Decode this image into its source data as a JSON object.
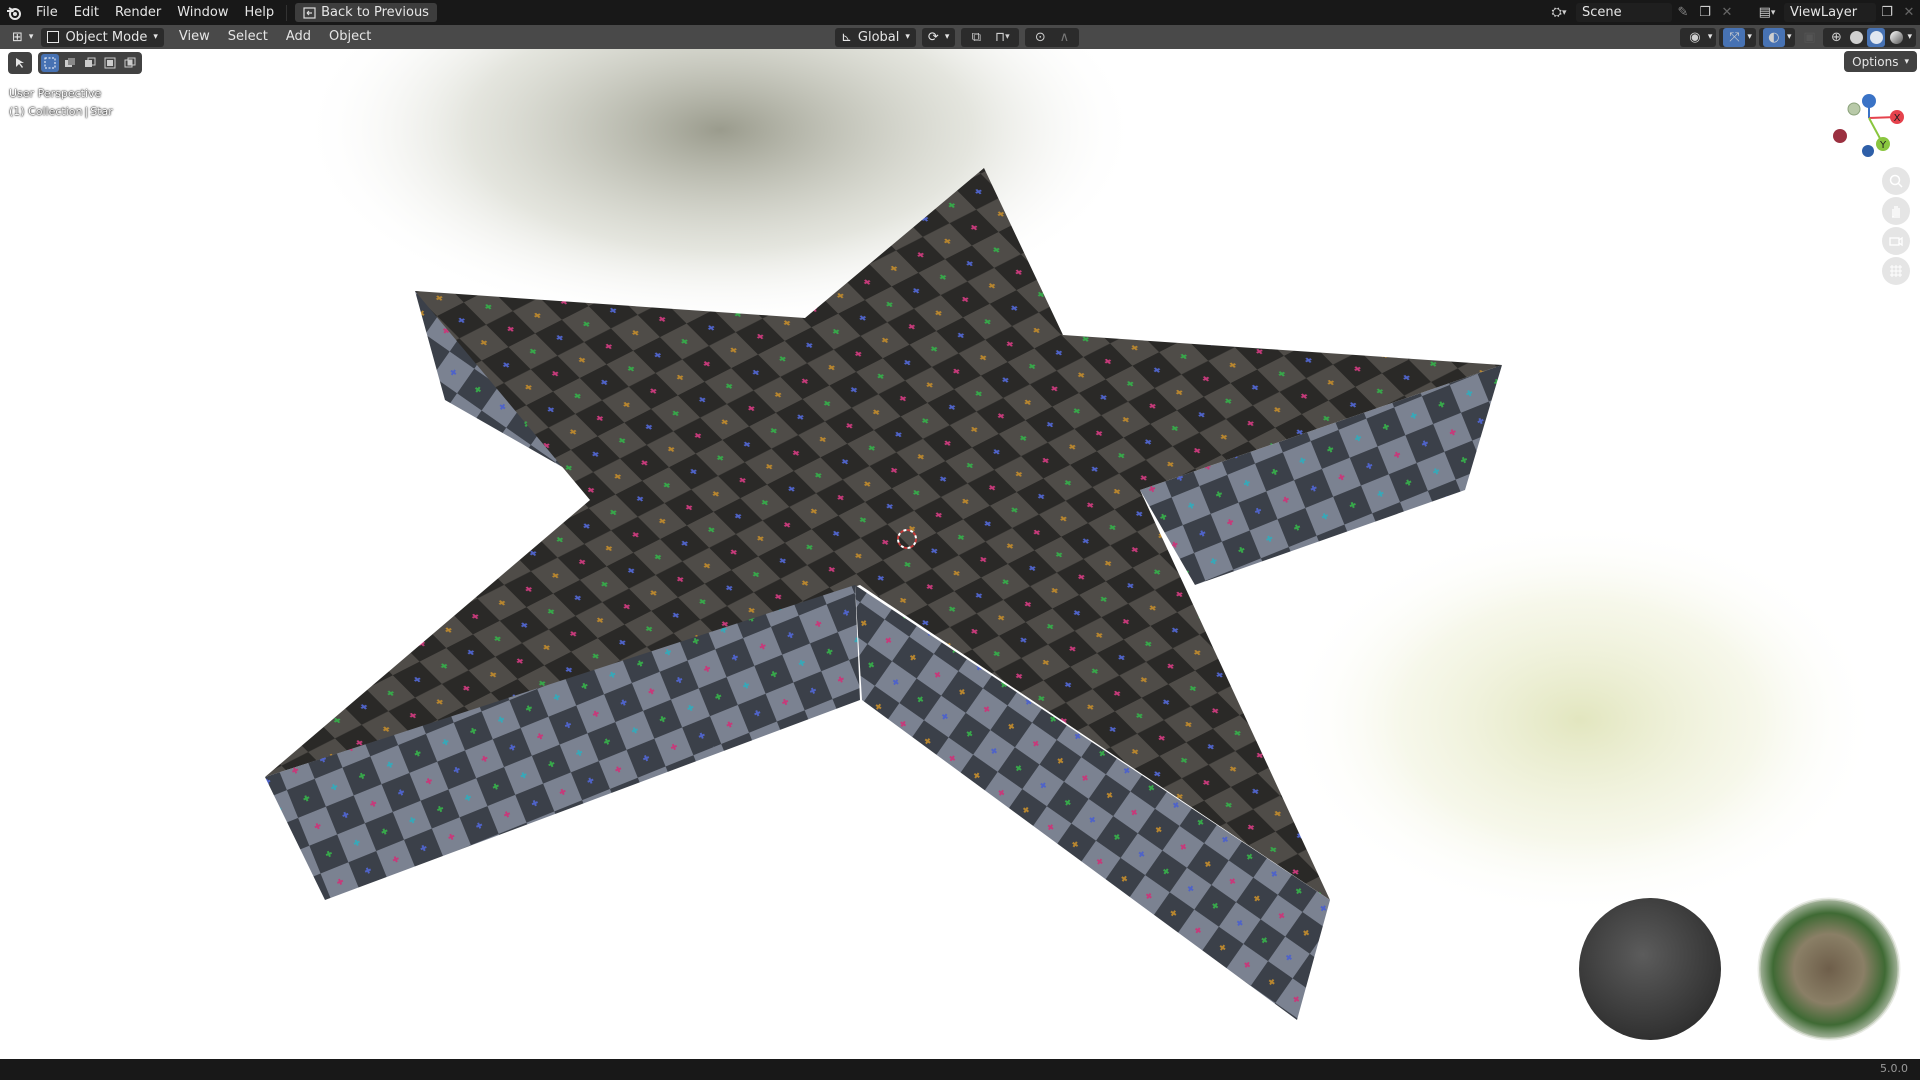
{
  "app": {
    "name": "Blender",
    "version": "5.0.0"
  },
  "topbar": {
    "menus": [
      "File",
      "Edit",
      "Render",
      "Window",
      "Help"
    ],
    "back_label": "Back to Previous",
    "scene_name": "Scene",
    "view_layer": "ViewLayer"
  },
  "header": {
    "mode": "Object Mode",
    "menus": [
      "View",
      "Select",
      "Add",
      "Object"
    ],
    "transform_orientation": "Global",
    "options_label": "Options"
  },
  "viewport": {
    "perspective_label": "User Perspective",
    "collection_label": "(1) Collection",
    "object_label": "Star"
  },
  "gizmo": {
    "x_label": "X",
    "y_label": "Y",
    "z_label": "Z"
  },
  "colors": {
    "accent": "#4772b3",
    "axis_x": "#e5424c",
    "axis_y": "#8ac63f",
    "axis_z": "#3a73c6",
    "topbar_bg": "#181818"
  },
  "icons": [
    "blender-logo-icon",
    "back-icon",
    "scene-icon",
    "pin-icon",
    "new-scene-icon",
    "close-icon",
    "viewlayer-icon",
    "editor-type-icon",
    "object-mode-icon",
    "orientation-icon",
    "pivot-icon",
    "snap-icon",
    "proportional-icon",
    "visibility-icon",
    "gizmo-icon",
    "overlay-icon",
    "xray-icon",
    "wireframe-shading-icon",
    "solid-shading-icon",
    "material-shading-icon",
    "rendered-shading-icon",
    "zoom-icon",
    "pan-icon",
    "camera-icon",
    "ortho-grid-icon"
  ]
}
